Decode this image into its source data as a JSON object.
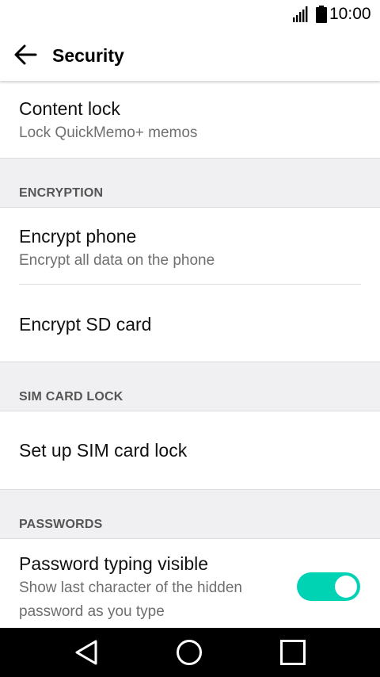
{
  "status_bar": {
    "time": "10:00",
    "icons": [
      "signal-icon",
      "battery-icon"
    ]
  },
  "toolbar": {
    "back_icon": "arrow-left-icon",
    "title": "Security"
  },
  "items": {
    "content_lock": {
      "title": "Content lock",
      "subtitle": "Lock QuickMemo+ memos"
    },
    "encrypt_phone": {
      "title": "Encrypt phone",
      "subtitle": "Encrypt all data on the phone"
    },
    "encrypt_sd": {
      "title": "Encrypt SD card"
    },
    "sim_lock": {
      "title": "Set up SIM card lock"
    },
    "password_visible": {
      "title": "Password typing visible",
      "subtitle_line1": "Show last character of the hidden",
      "subtitle_line2": "password as you type",
      "toggle_on": true
    }
  },
  "sections": {
    "encryption": "ENCRYPTION",
    "sim_card_lock": "SIM CARD LOCK",
    "passwords": "PASSWORDS"
  },
  "nav_bar": {
    "icons": [
      "back-triangle-icon",
      "home-circle-icon",
      "recents-square-icon"
    ]
  },
  "colors": {
    "accent": "#00d2b4",
    "section_bg": "#f0f0f2",
    "nav_bg": "#000000"
  }
}
